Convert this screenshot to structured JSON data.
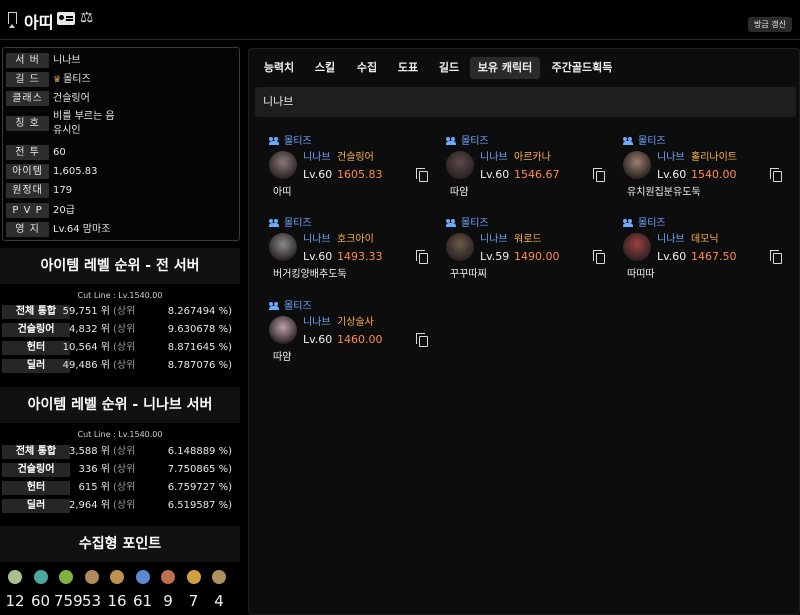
{
  "header": {
    "char_name": "아띠",
    "refresh_label": "방금 갱신"
  },
  "info": [
    {
      "label": "서 버",
      "value": "니나브"
    },
    {
      "label": "길 드",
      "value": "몰티즈"
    },
    {
      "label": "클래스",
      "value": "건슬링어"
    },
    {
      "label": "칭 호",
      "value": "비를 부르는 음",
      "value2": "유시인"
    },
    {
      "label": "전 투",
      "value": "60"
    },
    {
      "label": "아이템",
      "value": "1,605.83"
    },
    {
      "label": "원정대",
      "value": "179"
    },
    {
      "label": "P V P",
      "value": "20급"
    },
    {
      "label": "영 지",
      "value": "Lv.64 맘마조"
    }
  ],
  "rank_all": {
    "title": "아이템 레벨 순위 - 전 서버",
    "cutline": "Cut Line : Lv.1540.00",
    "rows": [
      {
        "label": "전체 통합",
        "value": "59,751 위",
        "sub": "(상위",
        "pct": "8.267494 %)"
      },
      {
        "label": "건슬링어",
        "value": "4,832 위",
        "sub": "(상위",
        "pct": "9.630678 %)"
      },
      {
        "label": "헌터",
        "value": "10,564 위",
        "sub": "(상위",
        "pct": "8.871645 %)"
      },
      {
        "label": "딜러",
        "value": "49,486 위",
        "sub": "(상위",
        "pct": "8.787076 %)"
      }
    ]
  },
  "rank_server": {
    "title": "아이템 레벨 순위 - 니나브 서버",
    "cutline": "Cut Line : Lv.1540.00",
    "rows": [
      {
        "label": "전체 통합",
        "value": "3,588 위",
        "sub": "(상위",
        "pct": "6.148889 %)"
      },
      {
        "label": "건슬링어",
        "value": "336 위",
        "sub": "(상위",
        "pct": "7.750865 %)"
      },
      {
        "label": "헌터",
        "value": "615 위",
        "sub": "(상위",
        "pct": "6.759727 %)"
      },
      {
        "label": "딜러",
        "value": "2,964 위",
        "sub": "(상위",
        "pct": "6.519587 %)"
      }
    ]
  },
  "collect": {
    "title": "수집형 포인트",
    "items": [
      {
        "icon": "mokoko-seed-icon",
        "color": "#a8c08a",
        "count": "12"
      },
      {
        "icon": "island-heart-icon",
        "color": "#4aa8a0",
        "count": "60"
      },
      {
        "icon": "world-tree-leaf-icon",
        "color": "#7fb040",
        "count": "759"
      },
      {
        "icon": "masterpiece-icon",
        "color": "#b08a5a",
        "count": "53"
      },
      {
        "icon": "orpheus-star-icon",
        "color": "#c09050",
        "count": "16"
      },
      {
        "icon": "sea-bounty-icon",
        "color": "#5a8ad0",
        "count": "61"
      },
      {
        "icon": "giant-heart-icon",
        "color": "#c07050",
        "count": "9"
      },
      {
        "icon": "ignea-token-icon",
        "color": "#d0a040",
        "count": "7"
      },
      {
        "icon": "eternal-flower-icon",
        "color": "#b09060",
        "count": "4"
      }
    ]
  },
  "tabs": [
    "능력치",
    "스킬",
    "수집",
    "도표",
    "길드",
    "보유 캐릭터",
    "주간골드획득"
  ],
  "active_tab": 5,
  "server_name": "니나브",
  "characters": [
    {
      "guild": "몰티즈",
      "server": "니나브",
      "class": "건슬링어",
      "level": "Lv.60",
      "ilvl": "1605.83",
      "name": "아띠",
      "portrait": "#8a7a78"
    },
    {
      "guild": "몰티즈",
      "server": "니나브",
      "class": "아르카나",
      "level": "Lv.60",
      "ilvl": "1546.67",
      "name": "따얌",
      "portrait": "#5a4a48"
    },
    {
      "guild": "몰티즈",
      "server": "니나브",
      "class": "홀리나이트",
      "level": "Lv.60",
      "ilvl": "1540.00",
      "name": "유치원집분유도둑",
      "portrait": "#9a8070"
    },
    {
      "guild": "몰티즈",
      "server": "니나브",
      "class": "호크아이",
      "level": "Lv.60",
      "ilvl": "1493.33",
      "name": "버거킹양배추도둑",
      "portrait": "#8a8a8a"
    },
    {
      "guild": "몰티즈",
      "server": "니나브",
      "class": "워로드",
      "level": "Lv.59",
      "ilvl": "1490.00",
      "name": "꾸꾸따찌",
      "portrait": "#6a5a48"
    },
    {
      "guild": "몰티즈",
      "server": "니나브",
      "class": "데모닉",
      "level": "Lv.60",
      "ilvl": "1467.50",
      "name": "따띠따",
      "portrait": "#a04040"
    },
    {
      "guild": "몰티즈",
      "server": "니나브",
      "class": "기상술사",
      "level": "Lv.60",
      "ilvl": "1460.00",
      "name": "따얌",
      "portrait": "#c0a0a8"
    }
  ]
}
